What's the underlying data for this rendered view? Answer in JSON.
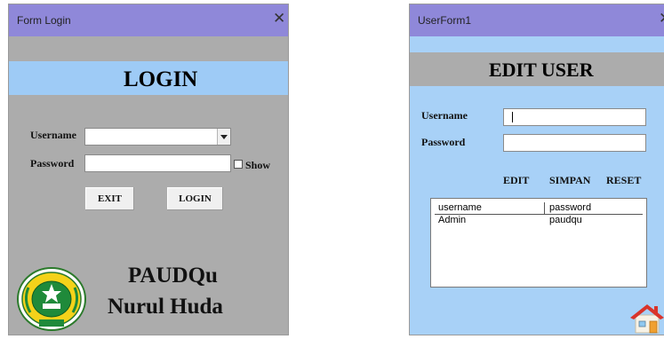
{
  "login_form": {
    "title": "Form Login",
    "close_glyph": "✕",
    "header": "LOGIN",
    "username_label": "Username",
    "username_value": "",
    "password_label": "Password",
    "password_value": "",
    "show_label": "Show",
    "exit_label": "EXIT",
    "login_label": "LOGIN",
    "brand_line1": "PAUDQu",
    "brand_line2": "Nurul Huda",
    "logo_icon": "school-emblem-icon"
  },
  "user_form": {
    "title": "UserForm1",
    "close_glyph": "✕",
    "header": "EDIT USER",
    "username_label": "Username",
    "username_value": "",
    "password_label": "Password",
    "password_value": "",
    "edit_label": "EDIT",
    "save_label": "SIMPAN",
    "reset_label": "RESET",
    "list": {
      "columns": [
        "username",
        "password"
      ],
      "rows": [
        {
          "username": "Admin",
          "password": "paudqu"
        }
      ]
    },
    "home_icon": "home-icon"
  },
  "colors": {
    "titlebar": "#8f88d9",
    "login_body": "#acacac",
    "login_header_band": "#9ecbf6",
    "user_body": "#a8d1f7",
    "user_header_band": "#acacac"
  }
}
